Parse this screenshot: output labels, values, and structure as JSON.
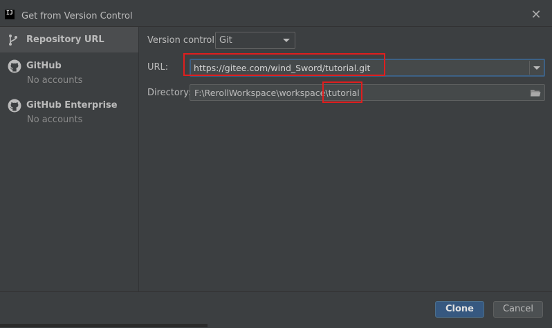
{
  "window": {
    "title": "Get from Version Control",
    "logo_text": "IJ",
    "close_glyph": "✕"
  },
  "sidebar": {
    "items": [
      {
        "label": "Repository URL",
        "icon": "branch-icon"
      },
      {
        "label": "GitHub",
        "sublabel": "No accounts",
        "icon": "github-icon"
      },
      {
        "label": "GitHub Enterprise",
        "sublabel": "No accounts",
        "icon": "github-icon"
      }
    ]
  },
  "form": {
    "vcs_label": "Version control:",
    "vcs_value": "Git",
    "url_label": "URL:",
    "url_value": "https://gitee.com/wind_Sword/tutorial.git",
    "dir_label": "Directory:",
    "dir_value": "F:\\RerollWorkspace\\workspace\\tutorial"
  },
  "footer": {
    "clone_label": "Clone",
    "cancel_label": "Cancel"
  },
  "colors": {
    "background": "#3c3f41",
    "accent": "#365880",
    "annotation": "#e01e1e"
  }
}
